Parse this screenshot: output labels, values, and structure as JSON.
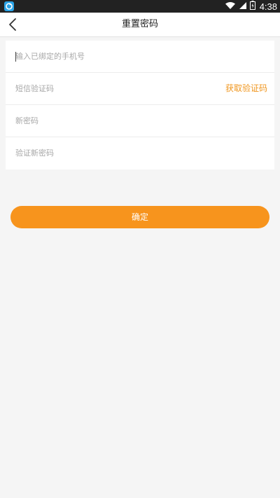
{
  "status_bar": {
    "time": "4:38"
  },
  "header": {
    "title": "重置密码"
  },
  "form": {
    "phone_placeholder": "输入已绑定的手机号",
    "sms_code_placeholder": "短信验证码",
    "get_code_label": "获取验证码",
    "new_password_placeholder": "新密码",
    "confirm_password_placeholder": "验证新密码"
  },
  "confirm_button_label": "确定",
  "colors": {
    "accent": "#f7941d",
    "link_accent": "#f0961e",
    "status_bar": "#222222",
    "background": "#f5f5f5"
  },
  "icons": {
    "app": "app-logo-icon",
    "wifi": "wifi-icon",
    "signal": "signal-icon",
    "battery": "battery-icon",
    "back": "back-arrow-icon"
  }
}
